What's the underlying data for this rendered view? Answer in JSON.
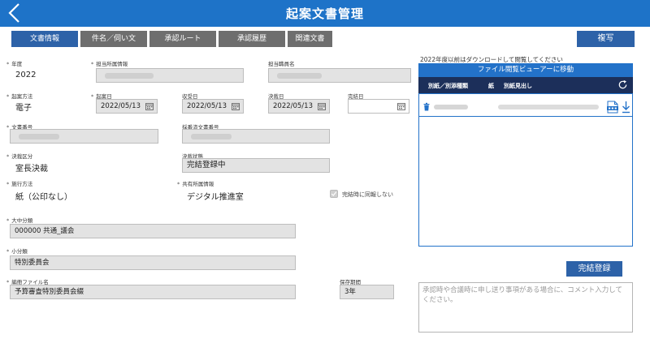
{
  "header": {
    "title": "起案文書管理"
  },
  "tabs": [
    {
      "label": "文書情報"
    },
    {
      "label": "件名／伺い文"
    },
    {
      "label": "承認ルート"
    },
    {
      "label": "承認履歴"
    },
    {
      "label": "関連文書"
    }
  ],
  "copy_label": "複写",
  "form": {
    "year": {
      "label": "年度",
      "value": "2022"
    },
    "dept": {
      "label": "担当所属情報"
    },
    "staff": {
      "label": "担当職員名"
    },
    "method": {
      "label": "起案方法",
      "value": "電子"
    },
    "draft_date": {
      "label": "起案日",
      "value": "2022/05/13"
    },
    "received_date": {
      "label": "収受日",
      "value": "2022/05/13"
    },
    "decision_date": {
      "label": "決裁日",
      "value": "2022/05/13"
    },
    "completion_date": {
      "label": "完結日",
      "value": ""
    },
    "doc_no": {
      "label": "文書番号"
    },
    "assigned_no": {
      "label": "採番済文書番号"
    },
    "decision_type": {
      "label": "決裁区分",
      "value": "室長決裁"
    },
    "decision_status": {
      "label": "決裁状態",
      "value": "完結登録中"
    },
    "execution": {
      "label": "施行方法",
      "value": "紙（公印なし）"
    },
    "shared_dept": {
      "label": "共有所属情報",
      "value": "デジタル推進室"
    },
    "sync_label": "完結時に同報しない",
    "major_cat": {
      "label": "大中分類",
      "value": "000000 共通_議会"
    },
    "minor_cat": {
      "label": "小分類",
      "value": "特別委員会"
    },
    "file_name": {
      "label": "編冊ファイル名",
      "value": "予算審査特別委員会綴"
    },
    "retention": {
      "label": "保存期間",
      "value": "3年"
    }
  },
  "files": {
    "note": "2022年度以前はダウンロードして閲覧してください",
    "viewer_button": "ファイル閲覧ビューアーに移動",
    "col_type": "別紙／別添種類",
    "col_paper": "紙",
    "col_title": "別紙見出し"
  },
  "complete_button": "完結登録",
  "comment": {
    "placeholder": "承認時や合議時に申し送り事項がある場合に、コメント入力してください。"
  },
  "colors": {
    "header": "#1e73c8",
    "accent": "#2d62a8",
    "tab_inactive": "#6e6e6e",
    "panel_head": "#1c2f5a"
  }
}
